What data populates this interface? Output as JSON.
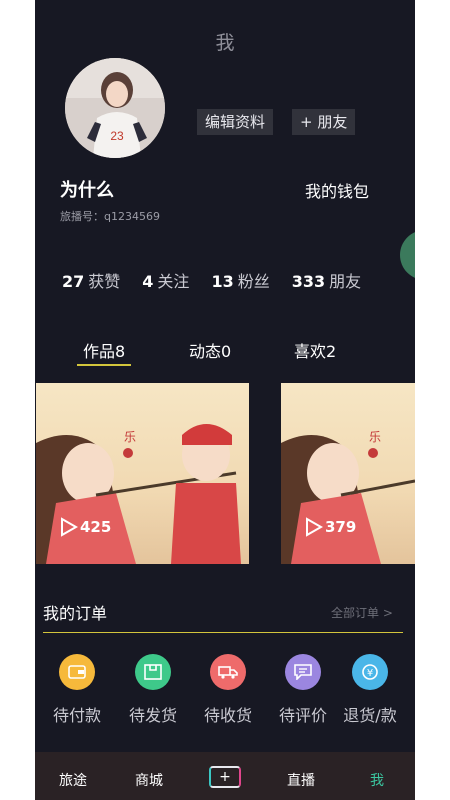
{
  "header": {
    "title": "我"
  },
  "profile": {
    "username": "为什么",
    "account_id": "旅播号：q1234569",
    "edit_label": "编辑资料",
    "add_friend_label": "+ 朋友",
    "wallet_label": "我的钱包"
  },
  "stats": [
    {
      "count": "27",
      "label": "获赞"
    },
    {
      "count": "4",
      "label": "关注"
    },
    {
      "count": "13",
      "label": "粉丝"
    },
    {
      "count": "333",
      "label": "朋友"
    }
  ],
  "tabs": [
    {
      "label": "作品8"
    },
    {
      "label": "动态0"
    },
    {
      "label": "喜欢2"
    }
  ],
  "videos": [
    {
      "play_count": "425"
    },
    {
      "play_count": "379"
    }
  ],
  "orders": {
    "title": "我的订单",
    "all_link": "全部订单 >",
    "items": [
      {
        "label": "待付款",
        "icon": "wallet-icon",
        "color": "#f6b93b"
      },
      {
        "label": "待发货",
        "icon": "package-icon",
        "color": "#3ec98a"
      },
      {
        "label": "待收货",
        "icon": "truck-icon",
        "color": "#ee6b6b"
      },
      {
        "label": "待评价",
        "icon": "comment-icon",
        "color": "#9b86e0"
      },
      {
        "label": "退货/款",
        "icon": "refund-icon",
        "color": "#4ab6e8"
      }
    ]
  },
  "bottom_nav": [
    {
      "label": "旅途"
    },
    {
      "label": "商城"
    },
    {
      "label": "直播"
    },
    {
      "label": "我"
    }
  ],
  "colors": {
    "accent": "#d3c53c",
    "background": "#171823",
    "active_nav": "#3bc7a0"
  }
}
